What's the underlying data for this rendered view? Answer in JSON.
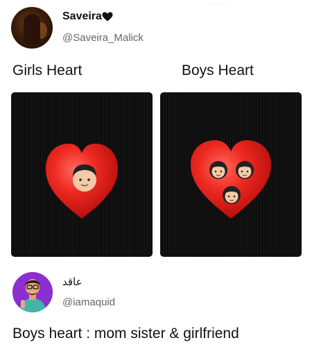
{
  "header_faint_text": "· · · · · ·",
  "post1": {
    "author_name": "Saveira",
    "author_handle": "@Saveira_Malick",
    "name_emoji": "black-heart-icon"
  },
  "meme": {
    "left_label": "Girls Heart",
    "right_label": "Boys Heart",
    "left_image_emoji": [
      "boy-face-icon"
    ],
    "right_image_emojis": [
      "girl-face-icon",
      "girl-face-icon",
      "girl-face-icon"
    ],
    "heart_color": "#e8231f",
    "panel_color": "#111111"
  },
  "post2": {
    "author_name": "عاقد",
    "author_handle": "@iamaquid",
    "caption": "Boys heart : mom sister & girlfriend",
    "avatar_bg": "#8b2fd0"
  }
}
